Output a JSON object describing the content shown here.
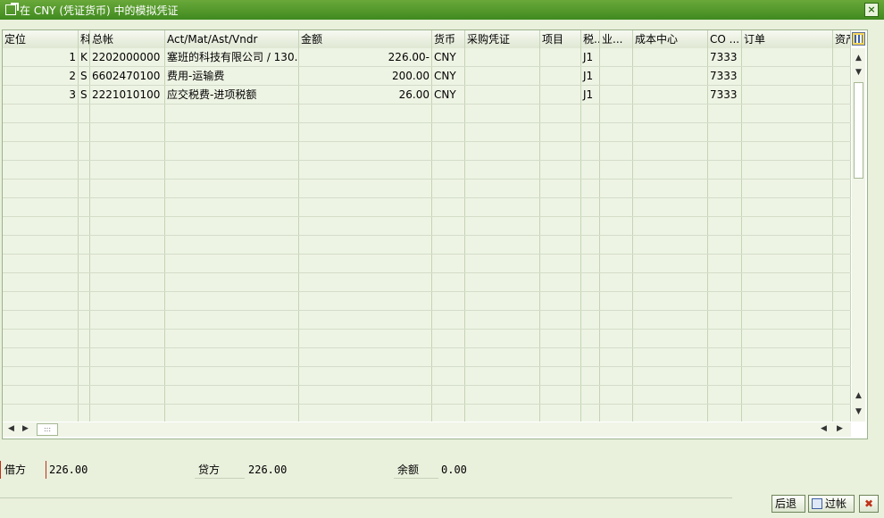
{
  "window": {
    "title": "在 CNY (凭证货币) 中的模拟凭证",
    "close_label": "×"
  },
  "grid": {
    "columns": [
      "定位",
      "科",
      "总帐",
      "Act/Mat/Ast/Vndr",
      "金额",
      "货币",
      "采购凭证",
      "项目",
      "税..",
      "业...",
      "成本中心",
      "CO ...",
      "订单",
      "资产"
    ],
    "rows": [
      [
        "1",
        "K",
        "2202000000",
        "塞班的科技有限公司 / 130..",
        "226.00-",
        "CNY",
        "",
        "",
        "J1",
        "",
        "",
        "7333",
        "",
        ""
      ],
      [
        "2",
        "S",
        "6602470100",
        "费用-运输费",
        "200.00",
        "CNY",
        "",
        "",
        "J1",
        "",
        "",
        "7333",
        "",
        ""
      ],
      [
        "3",
        "S",
        "2221010100",
        "应交税费-进项税额",
        "26.00",
        "CNY",
        "",
        "",
        "J1",
        "",
        "",
        "7333",
        "",
        ""
      ]
    ],
    "empty_rows": 16
  },
  "totals": {
    "debit_label": "借方",
    "debit_value": "226.00",
    "credit_label": "贷方",
    "credit_value": "226.00",
    "balance_label": "余额",
    "balance_value": "0.00"
  },
  "buttons": {
    "back_label": "后退",
    "post_label": "过帐"
  },
  "colors": {
    "title_bar": "#4a9326",
    "row_bg": "#eef4e4",
    "accent": "#c0321a"
  }
}
